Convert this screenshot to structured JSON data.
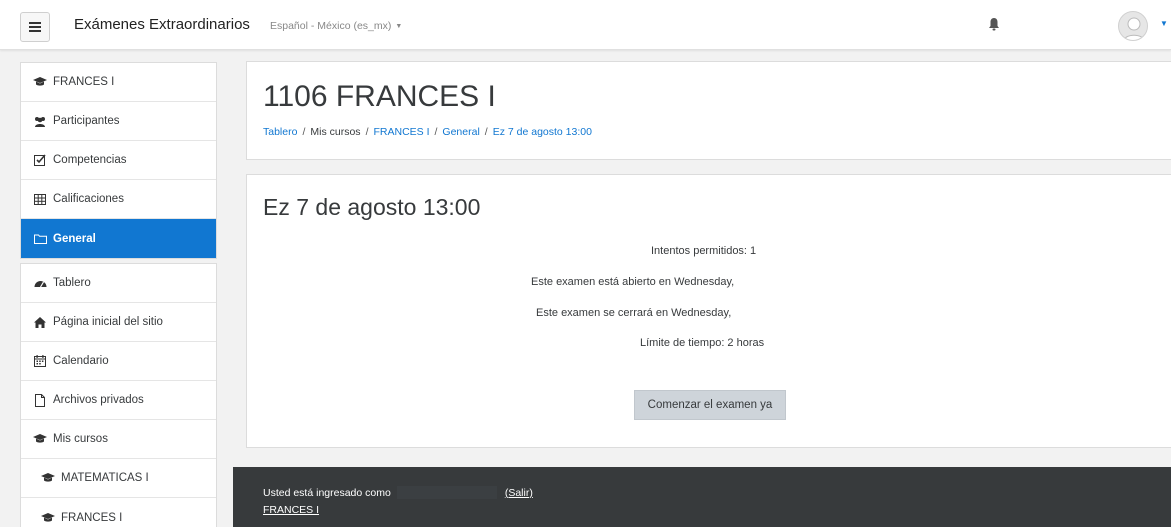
{
  "navbar": {
    "site_name": "Exámenes Extraordinarios",
    "language": "Español - México (es_mx)",
    "hamburger_icon": "hamburger-icon",
    "notification_icon": "bell-icon",
    "user_icon": "avatar"
  },
  "sidebar": {
    "course_group": [
      {
        "label": "FRANCES I",
        "icon": "graduation-cap-icon"
      },
      {
        "label": "Participantes",
        "icon": "users-icon"
      },
      {
        "label": "Competencias",
        "icon": "checkbox-icon"
      },
      {
        "label": "Calificaciones",
        "icon": "table-icon"
      },
      {
        "label": "General",
        "icon": "folder-icon",
        "active": true
      }
    ],
    "site_group": [
      {
        "label": "Tablero",
        "icon": "dashboard-icon"
      },
      {
        "label": "Página inicial del sitio",
        "icon": "home-icon"
      },
      {
        "label": "Calendario",
        "icon": "calendar-icon"
      },
      {
        "label": "Archivos privados",
        "icon": "file-icon"
      },
      {
        "label": "Mis cursos",
        "icon": "graduation-cap-icon"
      },
      {
        "label": "MATEMATICAS I",
        "icon": "graduation-cap-icon"
      },
      {
        "label": "FRANCES I",
        "icon": "graduation-cap-icon"
      }
    ]
  },
  "header": {
    "title": "1106 FRANCES I",
    "breadcrumb": [
      "Tablero",
      "Mis cursos",
      "FRANCES I",
      "General",
      "Ez 7 de agosto 13:00"
    ]
  },
  "quiz": {
    "title": "Ez 7 de agosto 13:00",
    "attempts": "Intentos permitidos: 1",
    "opens": "Este examen está abierto en Wednesday,",
    "closes": "Este examen se cerrará en Wednesday,",
    "time_limit": "Límite de tiempo: 2 horas",
    "start_button": "Comenzar el examen ya"
  },
  "footer": {
    "logged_in_text": "Usted está ingresado como",
    "logout_link": "(Salir)",
    "course_link": "FRANCES I"
  },
  "colors": {
    "accent": "#1177d1",
    "footer_bg": "#373a3c",
    "button_bg": "#ced4da"
  }
}
